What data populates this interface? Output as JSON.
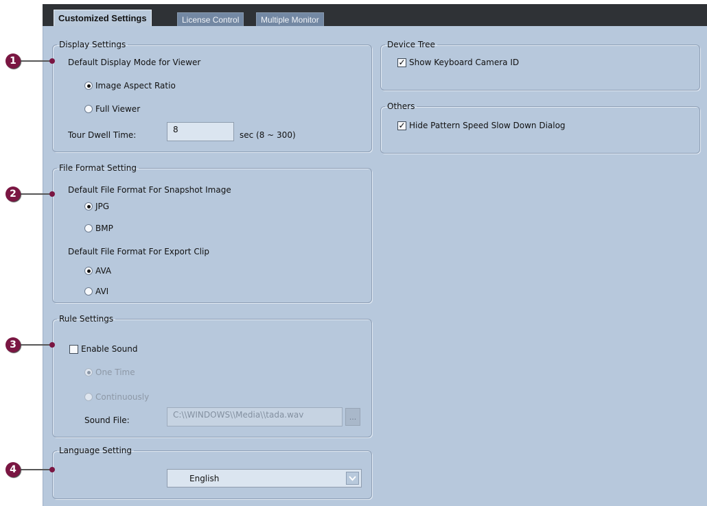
{
  "tabs": [
    {
      "label": "Customized Settings",
      "active": true
    },
    {
      "label": "License Control",
      "active": false
    },
    {
      "label": "Multiple Monitor",
      "active": false
    }
  ],
  "display_settings": {
    "legend": "Display Settings",
    "mode_label": "Default Display Mode for Viewer",
    "options": [
      "Image Aspect Ratio",
      "Full Viewer"
    ],
    "selected": "Image Aspect Ratio",
    "tour_label": "Tour Dwell Time:",
    "tour_value": "8",
    "tour_range": "sec (8 ~ 300)"
  },
  "file_format": {
    "legend": "File Format Setting",
    "snapshot_label": "Default File Format For Snapshot Image",
    "snapshot_options": [
      "JPG",
      "BMP"
    ],
    "snapshot_selected": "JPG",
    "export_label": "Default File Format For Export Clip",
    "export_options": [
      "AVA",
      "AVI"
    ],
    "export_selected": "AVA"
  },
  "rule_settings": {
    "legend": "Rule Settings",
    "enable_sound_label": "Enable Sound",
    "enable_sound_checked": false,
    "options": [
      "One Time",
      "Continuously"
    ],
    "selected": "One Time",
    "sound_file_label": "Sound File:",
    "sound_file_value": "C:\\\\WINDOWS\\\\Media\\\\tada.wav",
    "browse_label": "..."
  },
  "language_setting": {
    "legend": "Language Setting",
    "selected": "English"
  },
  "device_tree": {
    "legend": "Device Tree",
    "show_camera_id_label": "Show Keyboard Camera ID",
    "show_camera_id_checked": true
  },
  "others": {
    "legend": "Others",
    "hide_dialog_label": "Hide Pattern Speed Slow Down Dialog",
    "hide_dialog_checked": true
  },
  "callouts": [
    "1",
    "2",
    "3",
    "4"
  ],
  "colors": {
    "panel": "#b7c8dc",
    "tab_active": "#b9c9db",
    "tab_inactive": "#7388a3",
    "callout": "#7a1642",
    "header_bar": "#2f3236"
  }
}
